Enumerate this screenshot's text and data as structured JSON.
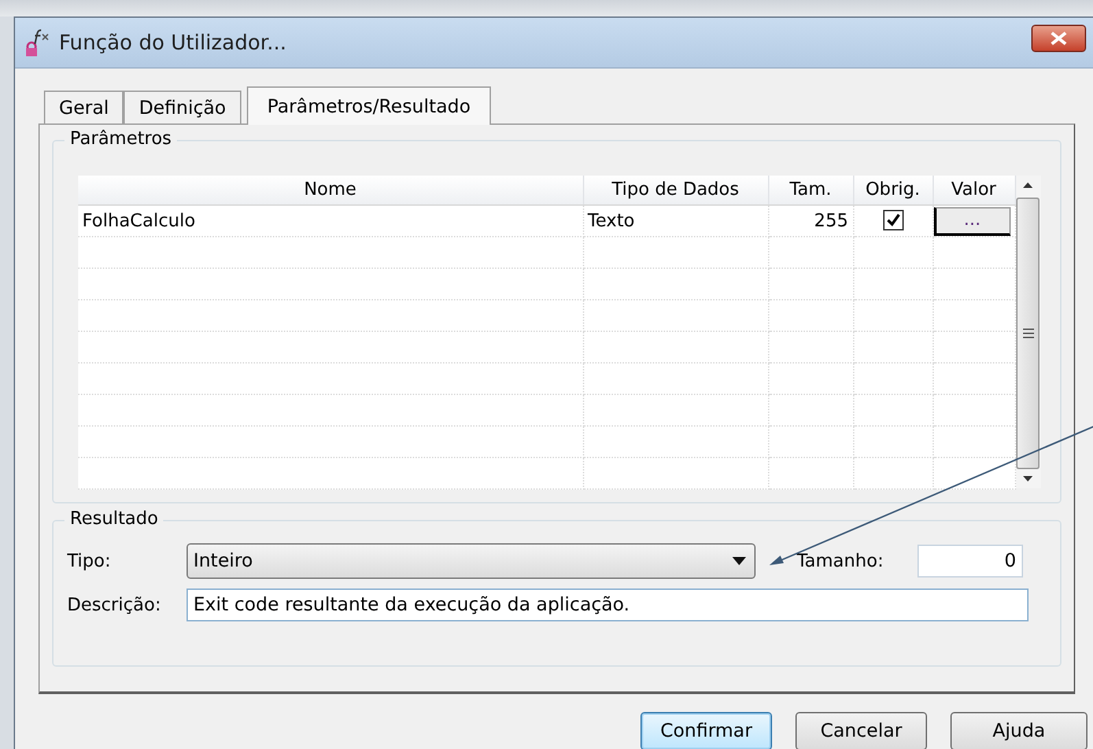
{
  "window": {
    "title": "Função do Utilizador..."
  },
  "tabs": [
    {
      "label": "Geral",
      "selected": false
    },
    {
      "label": "Definição",
      "selected": false
    },
    {
      "label": "Parâmetros/Resultado",
      "selected": true
    }
  ],
  "parameters": {
    "title": "Parâmetros",
    "columns": [
      "Nome",
      "Tipo de Dados",
      "Tam.",
      "Obrig.",
      "Valor"
    ],
    "rows": [
      {
        "name": "FolhaCalculo",
        "type": "Texto",
        "size": "255",
        "required": true,
        "value_button": "..."
      }
    ]
  },
  "result": {
    "title": "Resultado",
    "type_label": "Tipo:",
    "type_value": "Inteiro",
    "size_label": "Tamanho:",
    "size_value": "0",
    "description_label": "Descrição:",
    "description_value": "Exit code resultante da execução da aplicação."
  },
  "buttons": [
    {
      "label": "Confirmar",
      "default": true
    },
    {
      "label": "Cancelar",
      "default": false
    },
    {
      "label": "Ajuda",
      "default": false
    }
  ]
}
